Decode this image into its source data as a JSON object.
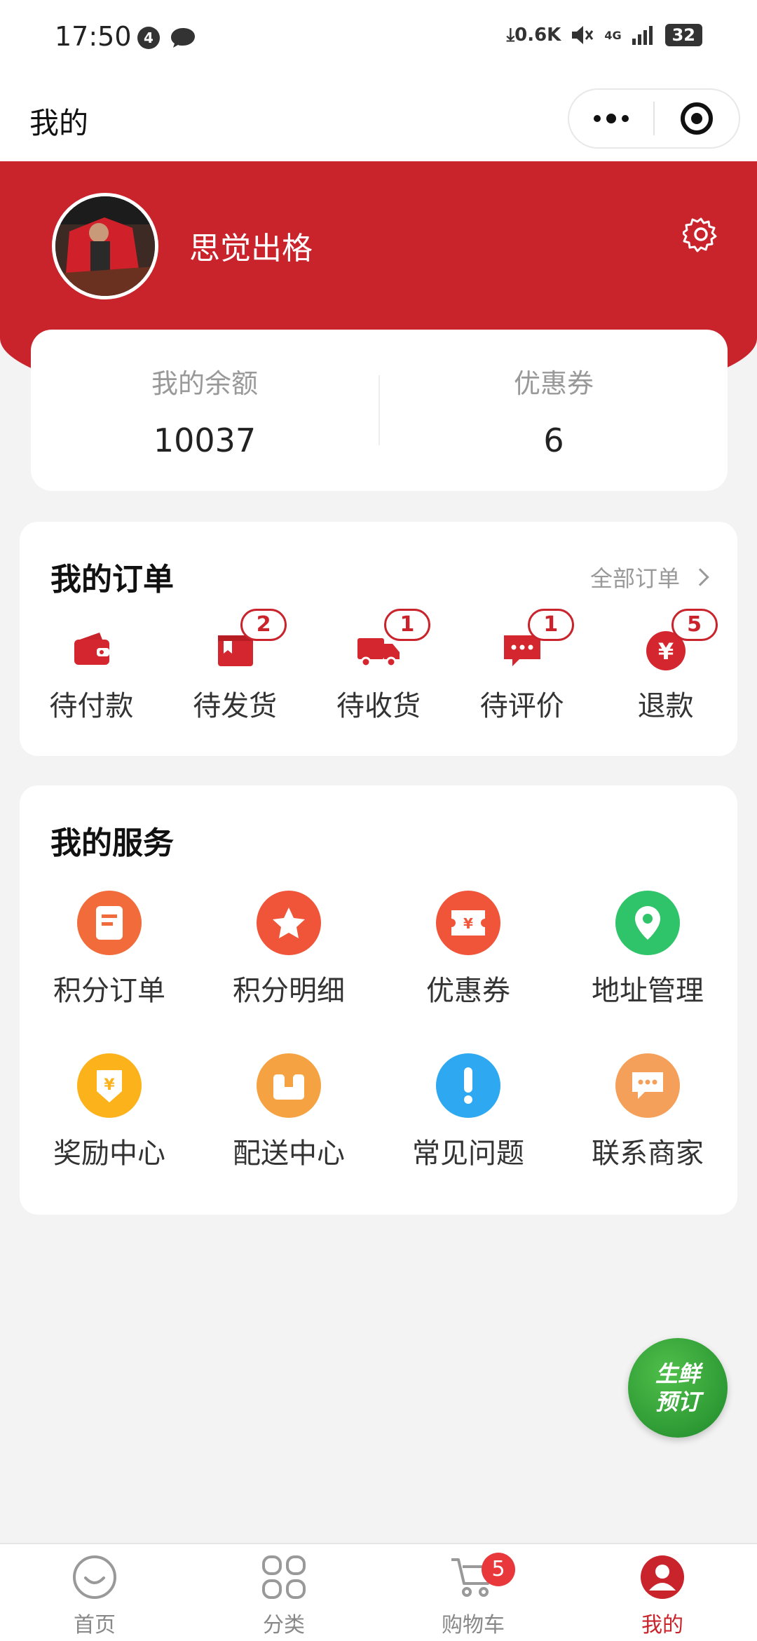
{
  "status_bar": {
    "time": "17:50",
    "notification_count": "4",
    "net_speed": "0.6K",
    "network": "4G",
    "battery": "32"
  },
  "nav": {
    "title": "我的"
  },
  "profile": {
    "username": "思觉出格"
  },
  "balance": {
    "balance_label": "我的余额",
    "balance_value": "10037",
    "coupon_label": "优惠券",
    "coupon_value": "6"
  },
  "orders": {
    "title": "我的订单",
    "all_link": "全部订单",
    "items": [
      {
        "label": "待付款",
        "icon": "wallet-icon",
        "badge": null
      },
      {
        "label": "待发货",
        "icon": "box-icon",
        "badge": "2"
      },
      {
        "label": "待收货",
        "icon": "truck-icon",
        "badge": "1"
      },
      {
        "label": "待评价",
        "icon": "comment-icon",
        "badge": "1"
      },
      {
        "label": "退款",
        "icon": "yen-icon",
        "badge": "5"
      }
    ]
  },
  "services": {
    "title": "我的服务",
    "items": [
      {
        "label": "积分订单",
        "icon": "points-order-icon",
        "color": "#f26b3a"
      },
      {
        "label": "积分明细",
        "icon": "star-icon",
        "color": "#f0553a"
      },
      {
        "label": "优惠券",
        "icon": "coupon-icon",
        "color": "#f0553a"
      },
      {
        "label": "地址管理",
        "icon": "location-icon",
        "color": "#2fc46a"
      },
      {
        "label": "奖励中心",
        "icon": "reward-icon",
        "color": "#fbb21b"
      },
      {
        "label": "配送中心",
        "icon": "delivery-icon",
        "color": "#f5a342"
      },
      {
        "label": "常见问题",
        "icon": "exclamation-icon",
        "color": "#2ea8f0"
      },
      {
        "label": "联系商家",
        "icon": "chat-icon",
        "color": "#f5a05a"
      }
    ]
  },
  "fab": {
    "line1": "生鲜",
    "line2": "预订"
  },
  "tab_bar": {
    "tabs": [
      {
        "label": "首页",
        "icon": "home-smile-icon"
      },
      {
        "label": "分类",
        "icon": "grid-icon"
      },
      {
        "label": "购物车",
        "icon": "cart-icon",
        "badge": "5"
      },
      {
        "label": "我的",
        "icon": "user-icon",
        "active": true
      }
    ]
  },
  "colors": {
    "brand_red": "#c9232b",
    "badge_red": "#e8383b"
  }
}
